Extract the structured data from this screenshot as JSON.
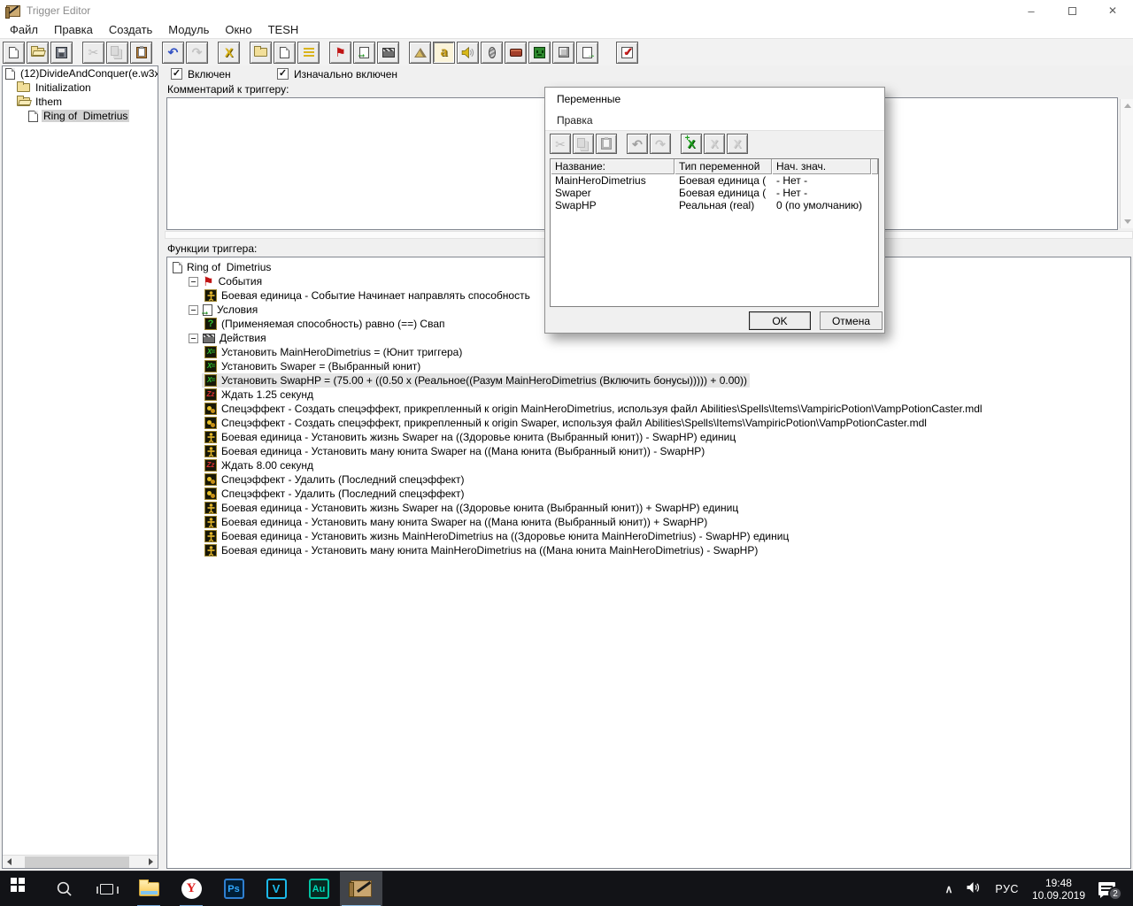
{
  "window": {
    "title": "Trigger Editor"
  },
  "menu": [
    "Файл",
    "Правка",
    "Создать",
    "Модуль",
    "Окно",
    "TESH"
  ],
  "toolbar": {
    "buttons": [
      {
        "icon": "new-document"
      },
      {
        "icon": "open-map"
      },
      {
        "icon": "save-map"
      },
      {
        "icon": "cut",
        "disabled": true,
        "gap": true
      },
      {
        "icon": "copy",
        "disabled": true
      },
      {
        "icon": "paste"
      },
      {
        "icon": "undo",
        "gap": true
      },
      {
        "icon": "redo",
        "disabled": true
      },
      {
        "icon": "delete-x",
        "gap": true
      },
      {
        "icon": "new-category",
        "gap": true
      },
      {
        "icon": "new-trigger"
      },
      {
        "icon": "new-comment"
      },
      {
        "icon": "new-event",
        "gap": true
      },
      {
        "icon": "new-condition"
      },
      {
        "icon": "new-action"
      },
      {
        "icon": "terrain-editor",
        "gap": true
      },
      {
        "icon": "trigger-editor",
        "pressed": true
      },
      {
        "icon": "sound-editor"
      },
      {
        "icon": "object-editor"
      },
      {
        "icon": "campaign-editor"
      },
      {
        "icon": "ai-editor"
      },
      {
        "icon": "object-manager"
      },
      {
        "icon": "import-manager"
      },
      {
        "icon": "check-list",
        "gap2": true
      }
    ]
  },
  "sidebar": {
    "items": [
      {
        "indent": 0,
        "icon": "map-page",
        "label": "(12)DivideAndConquer(e.w3x"
      },
      {
        "indent": 1,
        "icon": "folder-closed",
        "label": "Initialization"
      },
      {
        "indent": 1,
        "icon": "folder-open",
        "label": "Ithem"
      },
      {
        "indent": 2,
        "icon": "doc-page",
        "label": "Ring of  Dimetrius",
        "selected": true
      }
    ]
  },
  "trigger_panel": {
    "enabled_label": "Включен",
    "initially_on_label": "Изначально включен",
    "comment_label": "Комментарий к триггеру:",
    "comment_value": "",
    "functions_label": "Функции триггера:"
  },
  "functions_tree": {
    "items": [
      {
        "indent": 0,
        "icon": "doc-page",
        "label": "Ring of  Dimetrius"
      },
      {
        "indent": 1,
        "expander": true,
        "icon": "flag",
        "label": "События"
      },
      {
        "indent": 2,
        "icon": "unit",
        "label": "Боевая единица - Событие Начинает направлять способность"
      },
      {
        "indent": 1,
        "expander": true,
        "icon": "condition",
        "label": "Условия"
      },
      {
        "indent": 2,
        "icon": "question",
        "label": "(Применяемая способность) равно (==) Свап"
      },
      {
        "indent": 1,
        "expander": true,
        "icon": "clapper",
        "label": "Действия"
      },
      {
        "indent": 2,
        "icon": "setvar",
        "label": "Установить MainHeroDimetrius = (Юнит триггера)"
      },
      {
        "indent": 2,
        "icon": "setvar",
        "label": "Установить Swaper = (Выбранный юнит)"
      },
      {
        "indent": 2,
        "icon": "setvar",
        "selected": true,
        "label": "Установить SwapHP = (75.00 + ((0.50 x (Реальное((Разум MainHeroDimetrius (Включить бонусы))))) + 0.00))"
      },
      {
        "indent": 2,
        "icon": "wait",
        "label": "Ждать 1.25 секунд"
      },
      {
        "indent": 2,
        "icon": "effect",
        "label": "Спецэффект - Создать спецэффект, прикрепленный к origin MainHeroDimetrius, используя файл Abilities\\Spells\\Items\\VampiricPotion\\VampPotionCaster.mdl"
      },
      {
        "indent": 2,
        "icon": "effect",
        "label": "Спецэффект - Создать спецэффект, прикрепленный к origin Swaper, используя файл Abilities\\Spells\\Items\\VampiricPotion\\VampPotionCaster.mdl"
      },
      {
        "indent": 2,
        "icon": "unit",
        "label": "Боевая единица - Установить жизнь Swaper на ((Здоровье юнита (Выбранный юнит)) - SwapHP) единиц"
      },
      {
        "indent": 2,
        "icon": "unit",
        "label": "Боевая единица - Установить ману юнита Swaper на ((Мана юнита (Выбранный юнит)) - SwapHP)"
      },
      {
        "indent": 2,
        "icon": "wait",
        "label": "Ждать 8.00 секунд"
      },
      {
        "indent": 2,
        "icon": "effect",
        "label": "Спецэффект - Удалить (Последний спецэффект)"
      },
      {
        "indent": 2,
        "icon": "effect",
        "label": "Спецэффект - Удалить (Последний спецэффект)"
      },
      {
        "indent": 2,
        "icon": "unit",
        "label": "Боевая единица - Установить жизнь Swaper на ((Здоровье юнита (Выбранный юнит)) + SwapHP) единиц"
      },
      {
        "indent": 2,
        "icon": "unit",
        "label": "Боевая единица - Установить ману юнита Swaper на ((Мана юнита (Выбранный юнит)) + SwapHP)"
      },
      {
        "indent": 2,
        "icon": "unit",
        "label": "Боевая единица - Установить жизнь MainHeroDimetrius на ((Здоровье юнита MainHeroDimetrius) - SwapHP) единиц"
      },
      {
        "indent": 2,
        "icon": "unit",
        "label": "Боевая единица - Установить ману юнита MainHeroDimetrius на ((Мана юнита MainHeroDimetrius) - SwapHP)"
      }
    ]
  },
  "variables_dialog": {
    "title": "Переменные",
    "menu": [
      "Правка"
    ],
    "toolbar": [
      {
        "icon": "cut",
        "disabled": true
      },
      {
        "icon": "copy",
        "disabled": true
      },
      {
        "icon": "paste",
        "disabled": true
      },
      {
        "icon": "undo",
        "disabled": true,
        "gap": true
      },
      {
        "icon": "redo",
        "disabled": true
      },
      {
        "icon": "new-variable",
        "gap": true
      },
      {
        "icon": "rename-variable",
        "disabled": true
      },
      {
        "icon": "delete-variable",
        "disabled": true
      }
    ],
    "columns": [
      "Название:",
      "Тип переменной",
      "Нач. знач."
    ],
    "rows": [
      {
        "name": "MainHeroDimetrius",
        "type": "Боевая единица (",
        "initial": "- Нет -"
      },
      {
        "name": "Swaper",
        "type": "Боевая единица (",
        "initial": "- Нет -"
      },
      {
        "name": "SwapHP",
        "type": "Реальная (real)",
        "initial": "0 (по умолчанию)"
      }
    ],
    "ok_label": "OK",
    "cancel_label": "Отмена"
  },
  "taskbar": {
    "apps": [
      {
        "name": "start-button",
        "kind": "start"
      },
      {
        "name": "search-button",
        "kind": "search"
      },
      {
        "name": "task-view-button",
        "kind": "taskview"
      },
      {
        "name": "file-explorer-app",
        "kind": "explorer",
        "running": true
      },
      {
        "name": "yandex-browser-app",
        "kind": "yandex",
        "label": "Y",
        "running": true
      },
      {
        "name": "photoshop-app",
        "kind": "ps",
        "label": "Ps"
      },
      {
        "name": "vegas-app",
        "kind": "vegas",
        "label": "V"
      },
      {
        "name": "audition-app",
        "kind": "au",
        "label": "Au"
      },
      {
        "name": "world-editor-app",
        "kind": "we",
        "running": true,
        "active": true
      }
    ],
    "tray": {
      "lang": "РУС",
      "time": "19:48",
      "date": "10.09.2019",
      "notification_count": "2"
    }
  }
}
